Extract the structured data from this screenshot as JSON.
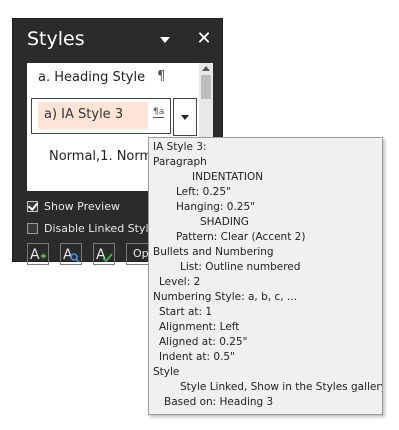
{
  "pane": {
    "title": "Styles",
    "styles": [
      {
        "label": "a.  Heading Style",
        "mark": "¶"
      },
      {
        "label": "a)  IA Style 3",
        "mark": "¶a"
      },
      {
        "label": "Normal,1. Norm"
      }
    ],
    "show_preview": {
      "label": "Show Preview",
      "checked": true
    },
    "disable_linked": {
      "label": "Disable Linked Style",
      "checked": false
    },
    "buttons": {
      "new_style_icon": "new-style-icon",
      "style_inspector_icon": "style-inspector-icon",
      "manage_styles_icon": "manage-styles-icon",
      "options_label": "Op"
    }
  },
  "tooltip": {
    "lines": [
      "IA Style 3:",
      "Paragraph",
      "INDENTATION",
      "Left:  0.25\"",
      "Hanging:  0.25\"",
      "SHADING",
      "Pattern: Clear (Accent 2)",
      "Bullets and Numbering",
      "List:  Outline numbered",
      "Level: 2",
      "Numbering Style:   a, b, c, ...",
      "Start at: 1",
      "Alignment: Left",
      "Aligned at:  0.25\"",
      "Indent at:  0.5\"",
      "Style",
      "Style Linked, Show in the Styles gallery",
      "Based on: Heading 3"
    ]
  },
  "colors": {
    "pane_bg": "#2b2b2b",
    "selected_style_bg": "#fde4d6",
    "tooltip_bg": "#f0f0f0",
    "icon_green": "#4caf50",
    "icon_blue": "#4a8fe0"
  }
}
